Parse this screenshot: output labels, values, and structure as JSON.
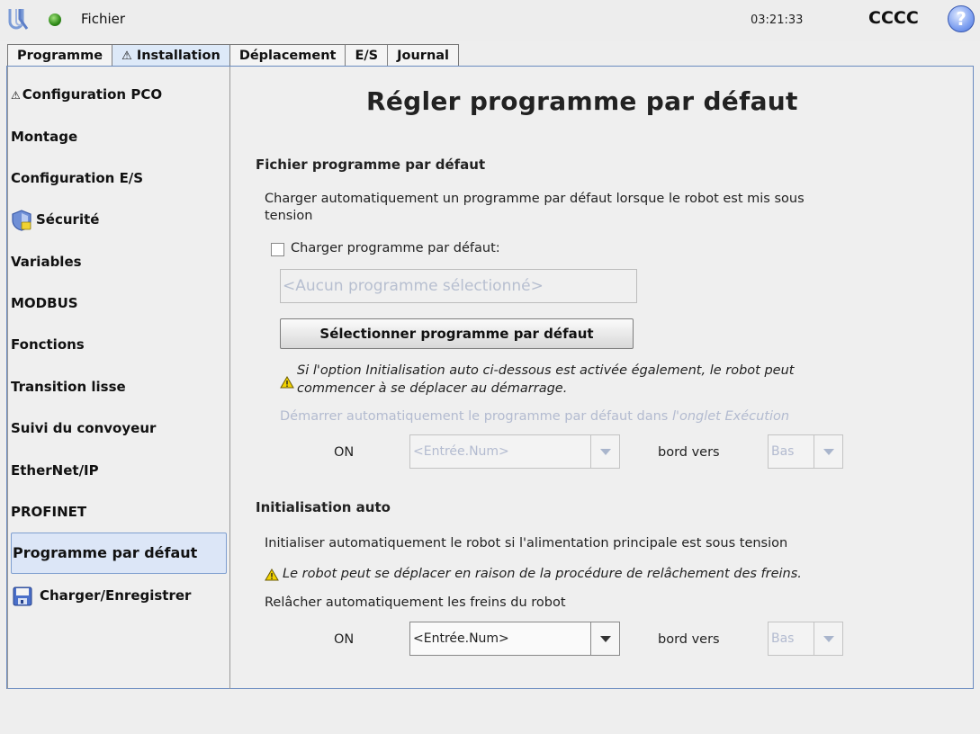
{
  "header": {
    "file_menu": "Fichier",
    "clock": "03:21:33",
    "robot_name": "CCCC",
    "help": "?"
  },
  "tabs": [
    {
      "label": "Programme"
    },
    {
      "label": "Installation",
      "warning": true
    },
    {
      "label": "Déplacement"
    },
    {
      "label": "E/S"
    },
    {
      "label": "Journal"
    }
  ],
  "sidebar": {
    "items": [
      {
        "label": "Configuration PCO",
        "icon": "warning-icon"
      },
      {
        "label": "Montage"
      },
      {
        "label": "Configuration E/S"
      },
      {
        "label": "Sécurité",
        "icon": "shield-icon"
      },
      {
        "label": "Variables"
      },
      {
        "label": "MODBUS"
      },
      {
        "label": "Fonctions"
      },
      {
        "label": "Transition lisse"
      },
      {
        "label": "Suivi du convoyeur"
      },
      {
        "label": "EtherNet/IP"
      },
      {
        "label": "PROFINET"
      },
      {
        "label": "Programme par défaut",
        "active": true
      },
      {
        "label": "Charger/Enregistrer",
        "icon": "floppy-disk-icon"
      }
    ]
  },
  "main": {
    "title": "Régler programme par défaut",
    "default_file": {
      "section_title": "Fichier programme par défaut",
      "description_line1": "Charger automatiquement un programme par défaut lorsque le robot est mis sous",
      "description_line2": "tension",
      "checkbox_label": "Charger programme par défaut:",
      "checkbox_checked": false,
      "program_field": "<Aucun programme sélectionné>",
      "select_button": "Sélectionner programme par défaut",
      "warning_line1": "Si l'option Initialisation auto ci-dessous est activée également, le robot peut",
      "warning_line2": "commencer à se déplacer au démarrage.",
      "autostart_text": "Démarrer automatiquement le programme par défaut dans ",
      "autostart_italic": "l'onglet Exécution",
      "on_label": "ON",
      "input_select": "<Entrée.Num>",
      "edge_label": "bord vers",
      "edge_select": "Bas"
    },
    "auto_init": {
      "section_title": "Initialisation auto",
      "description": "Initialiser automatiquement le robot si l'alimentation principale est sous tension",
      "warning": "Le robot peut se déplacer en raison de la procédure de relâchement des freins.",
      "brake_release_label": "Relâcher automatiquement les freins du robot",
      "on_label": "ON",
      "input_select": "<Entrée.Num>",
      "edge_label": "bord vers",
      "edge_select": "Bas"
    }
  },
  "colors": {
    "active_tab": "#dde9f8",
    "frame_border": "#6a8bc0",
    "disabled_text": "#b3bbd0",
    "warning_yellow": "#f2d200"
  }
}
